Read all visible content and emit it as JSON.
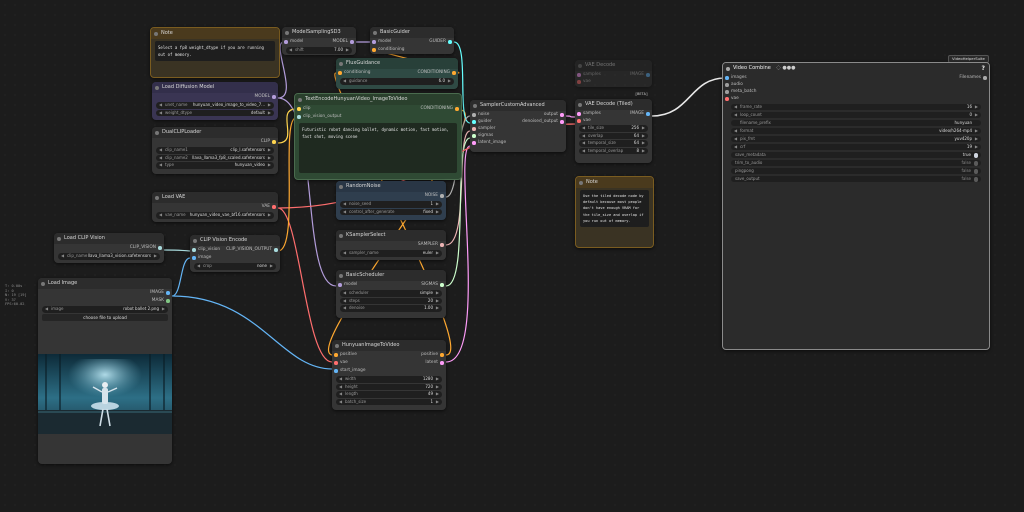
{
  "colors": {
    "model": "#b39ddb",
    "clip": "#ffd54f",
    "vae": "#ff6e6e",
    "conditioning": "#ffa931",
    "image": "#64b5f6",
    "latent": "#ff9cf9",
    "clip_vision": "#a8dadc",
    "noise": "#b0b0b0",
    "guider": "#66ffff",
    "sampler": "#ecb4b4",
    "sigmas": "#cdffcd",
    "note_border": "#7a5c20",
    "note_bg": "#3a3323"
  },
  "info_overlay": [
    "T: 0.00s",
    "I: 0",
    "N: 19 [19]",
    "V: 37",
    "FPS:60.02"
  ],
  "nodes": {
    "note1": {
      "title": "Note",
      "text": "Select a fp8 weight_dtype if you are running out of memory."
    },
    "model_sampling": {
      "title": "ModelSamplingSD3",
      "in_model": "model",
      "out_model": "MODEL",
      "shift_label": "shift",
      "shift_value": "7.00"
    },
    "basic_guider": {
      "title": "BasicGuider",
      "in_model": "model",
      "in_conditioning": "conditioning",
      "out_guider": "GUIDER"
    },
    "flux_guidance": {
      "title": "FluxGuidance",
      "in_conditioning": "conditioning",
      "out_conditioning": "CONDITIONING",
      "guidance_label": "guidance",
      "guidance_value": "6.0"
    },
    "load_diffusion": {
      "title": "Load Diffusion Model",
      "out_model": "MODEL",
      "unet_label": "unet_name",
      "unet_value": "hunyuan_video_image_to_video_7...",
      "dtype_label": "weight_dtype",
      "dtype_value": "default"
    },
    "dual_clip": {
      "title": "DualCLIPLoader",
      "out_clip": "CLIP",
      "clip1_label": "clip_name1",
      "clip1_value": "clip_l.safetensors",
      "clip2_label": "clip_name2",
      "clip2_value": "llava_llama3_fp8_scaled.safetensors",
      "type_label": "type",
      "type_value": "hunyuan_video"
    },
    "text_encode": {
      "title": "TextEncodeHunyuanVideo_ImageToVideo",
      "in_clip": "clip",
      "in_clip_vision": "clip_vision_output",
      "out_conditioning": "CONDITIONING",
      "text": "Futuristic robot dancing ballet, dynamic motion, fast motion, fast shot, moving scene"
    },
    "load_vae": {
      "title": "Load VAE",
      "out_vae": "VAE",
      "vae_label": "vae_name",
      "vae_value": "hunyuan_video_vae_bf16.safetensors"
    },
    "random_noise": {
      "title": "RandomNoise",
      "out_noise": "NOISE",
      "seed_label": "noise_seed",
      "seed_value": "1",
      "control_label": "control_after_generate",
      "control_value": "fixed"
    },
    "ksampler_select": {
      "title": "KSamplerSelect",
      "out_sampler": "SAMPLER",
      "sampler_label": "sampler_name",
      "sampler_value": "euler"
    },
    "basic_scheduler": {
      "title": "BasicScheduler",
      "in_model": "model",
      "out_sigmas": "SIGMAS",
      "scheduler_label": "scheduler",
      "scheduler_value": "simple",
      "steps_label": "steps",
      "steps_value": "20",
      "denoise_label": "denoise",
      "denoise_value": "1.00"
    },
    "load_clip_vision": {
      "title": "Load CLIP Vision",
      "out": "CLIP_VISION",
      "name_label": "clip_name",
      "name_value": "llava_llama3_vision.safetensors"
    },
    "clip_vision_encode": {
      "title": "CLIP Vision Encode",
      "in_clip_vision": "clip_vision",
      "in_image": "image",
      "out": "CLIP_VISION_OUTPUT",
      "crop_label": "crop",
      "crop_value": "none"
    },
    "load_image": {
      "title": "Load Image",
      "out_image": "IMAGE",
      "out_mask": "MASK",
      "image_label": "image",
      "image_value": "robot ballet 2.png",
      "upload_label": "choose file to upload"
    },
    "sampler_custom": {
      "title": "SamplerCustomAdvanced",
      "in_noise": "noise",
      "in_guider": "guider",
      "in_sampler": "sampler",
      "in_sigmas": "sigmas",
      "in_latent": "latent_image",
      "out_output": "output",
      "out_denoised": "denoised_output"
    },
    "vae_decode": {
      "title": "VAE Decode",
      "in_samples": "samples",
      "in_vae": "vae",
      "out_image": "IMAGE"
    },
    "vae_decode_tiled": {
      "title": "VAE Decode (Tiled)",
      "beta": "[BETA]",
      "in_samples": "samples",
      "in_vae": "vae",
      "out_image": "IMAGE",
      "tile_label": "tile_size",
      "tile_value": "256",
      "overlap_label": "overlap",
      "overlap_value": "64",
      "ttile_label": "temporal_size",
      "ttile_value": "64",
      "toverlap_label": "temporal_overlap",
      "toverlap_value": "8"
    },
    "note2": {
      "title": "Note",
      "text": "Use the tiled decode node by default because most people don't have enough VRAM for the tile_size and overlap if you run out of memory."
    },
    "hunyuan_i2v": {
      "title": "HunyuanImageToVideo",
      "in_positive": "positive",
      "in_vae": "vae",
      "in_start": "start_image",
      "out_positive": "positive",
      "out_latent": "latent",
      "width_label": "width",
      "width_value": "1280",
      "height_label": "height",
      "height_value": "720",
      "length_label": "length",
      "length_value": "49",
      "batch_label": "batch_size",
      "batch_value": "1"
    },
    "video_combine": {
      "suite": "VideoHelperSuite",
      "title": "Video Combine",
      "help": "?",
      "in_images": "images",
      "in_audio": "audio",
      "in_meta": "meta_batch",
      "in_vae": "vae",
      "out_filenames": "Filenames",
      "widgets": [
        {
          "label": "frame_rate",
          "value": "16"
        },
        {
          "label": "loop_count",
          "value": "0"
        },
        {
          "label": "filename_prefix",
          "value": "hunyuan"
        },
        {
          "label": "format",
          "value": "video/h264-mp4"
        },
        {
          "label": "pix_fmt",
          "value": "yuv420p"
        },
        {
          "label": "crf",
          "value": "19"
        }
      ],
      "toggles": [
        {
          "label": "save_metadata",
          "value": "true",
          "on": true
        },
        {
          "label": "trim_to_audio",
          "value": "false",
          "on": false
        },
        {
          "label": "pingpong",
          "value": "false",
          "on": false
        },
        {
          "label": "save_output",
          "value": "false",
          "on": false
        }
      ]
    }
  }
}
